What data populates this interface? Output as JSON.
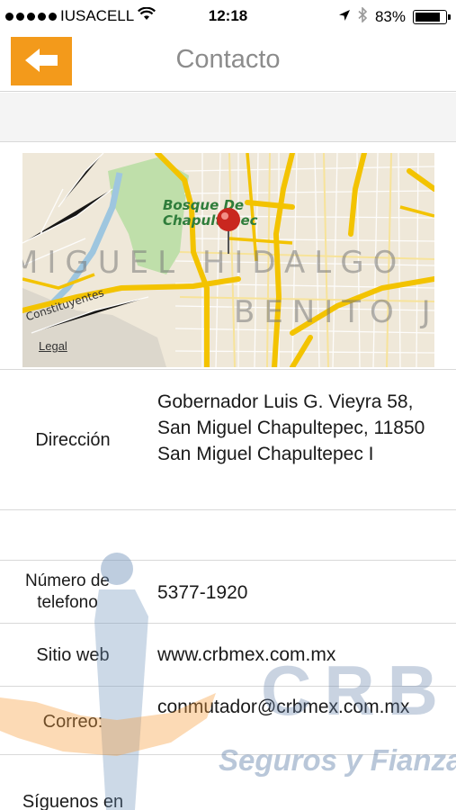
{
  "status_bar": {
    "carrier": "IUSACELL",
    "time": "12:18",
    "battery_percent_label": "83%",
    "battery_level": 0.83
  },
  "nav": {
    "title": "Contacto",
    "back_icon": "left-arrow-icon",
    "accent_color": "#f39a1b"
  },
  "map": {
    "labels": {
      "park_line1": "Bosque De",
      "park_line2": "Chapultepec",
      "district_1": "MIGUEL HIDALGO",
      "district_2": "BENITO J",
      "street": "Constituyentes"
    },
    "legal": "Legal",
    "pin_icon": "map-pin-icon"
  },
  "contact": {
    "address_label": "Dirección",
    "address_value": "Gobernador Luis G. Vieyra 58, San Miguel Chapultepec, 11850 San Miguel Chapultepec I",
    "phone_label": "Número de telefono",
    "phone_value": "5377-1920",
    "web_label": "Sitio web",
    "web_value": "www.crbmex.com.mx",
    "email_label": "Correo:",
    "email_value": "conmutador@crbmex.com.mx",
    "social_label": "Síguenos en"
  },
  "watermark": {
    "brand": "CRB",
    "tagline": "Seguros y Fianzas"
  }
}
